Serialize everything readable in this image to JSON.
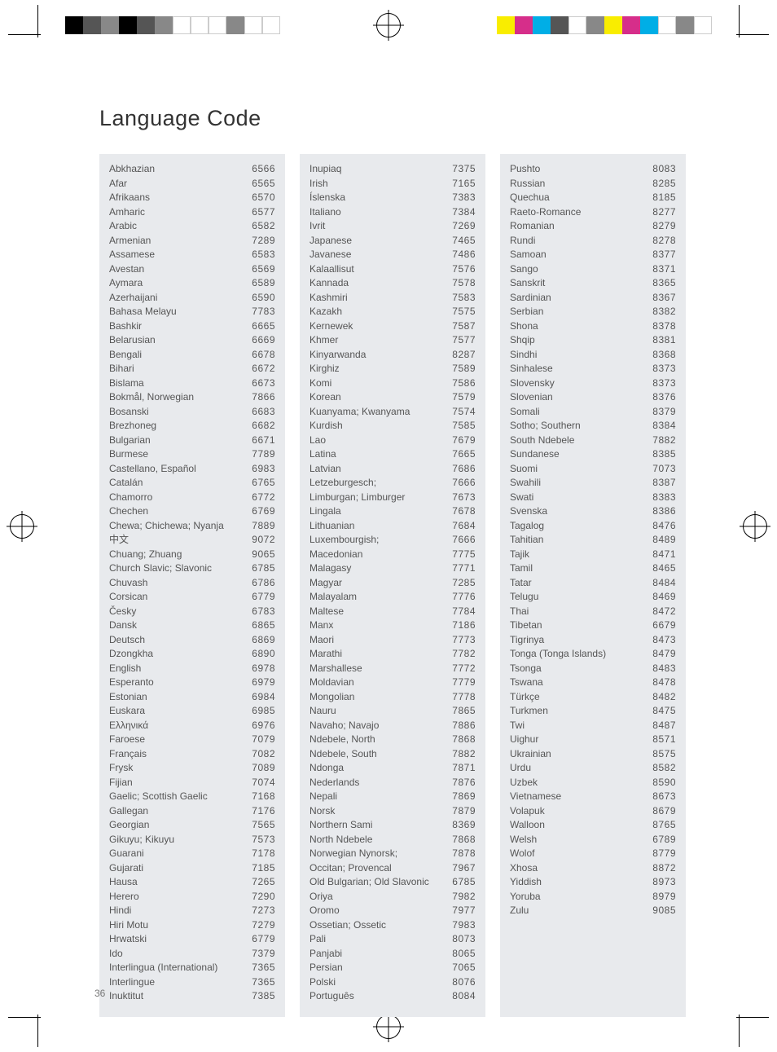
{
  "title": "Language Code",
  "page_number": "36",
  "swatches_left": [
    "#000000",
    "#555555",
    "#888888",
    "#000000",
    "#555555",
    "#888888",
    "#ffffff",
    "#ffffff",
    "#ffffff",
    "#888888",
    "#ffffff",
    "#ffffff"
  ],
  "swatches_right": [
    "#f9ed00",
    "#d62e8a",
    "#00aee6",
    "#555555",
    "#ffffff",
    "#888888",
    "#f9ed00",
    "#d62e8a",
    "#00aee6",
    "#ffffff",
    "#888888",
    "#ffffff"
  ],
  "columns": [
    [
      {
        "n": "Abkhazian",
        "c": "6566"
      },
      {
        "n": "Afar",
        "c": "6565"
      },
      {
        "n": "Afrikaans",
        "c": "6570"
      },
      {
        "n": "Amharic",
        "c": "6577"
      },
      {
        "n": "Arabic",
        "c": "6582"
      },
      {
        "n": "Armenian",
        "c": "7289"
      },
      {
        "n": "Assamese",
        "c": "6583"
      },
      {
        "n": "Avestan",
        "c": "6569"
      },
      {
        "n": "Aymara",
        "c": "6589"
      },
      {
        "n": "Azerhaijani",
        "c": "6590"
      },
      {
        "n": "Bahasa Melayu",
        "c": "7783"
      },
      {
        "n": "Bashkir",
        "c": "6665"
      },
      {
        "n": "Belarusian",
        "c": "6669"
      },
      {
        "n": "Bengali",
        "c": "6678"
      },
      {
        "n": "Bihari",
        "c": "6672"
      },
      {
        "n": "Bislama",
        "c": "6673"
      },
      {
        "n": "Bokmål, Norwegian",
        "c": "7866"
      },
      {
        "n": "Bosanski",
        "c": "6683"
      },
      {
        "n": "Brezhoneg",
        "c": "6682"
      },
      {
        "n": "Bulgarian",
        "c": "6671"
      },
      {
        "n": "Burmese",
        "c": "7789"
      },
      {
        "n": "Castellano, Español",
        "c": "6983"
      },
      {
        "n": "Catalán",
        "c": "6765"
      },
      {
        "n": "Chamorro",
        "c": "6772"
      },
      {
        "n": "Chechen",
        "c": "6769"
      },
      {
        "n": "Chewa; Chichewa; Nyanja",
        "c": "7889"
      },
      {
        "n": "中文",
        "c": "9072"
      },
      {
        "n": "Chuang; Zhuang",
        "c": "9065"
      },
      {
        "n": "Church Slavic; Slavonic",
        "c": "6785"
      },
      {
        "n": "Chuvash",
        "c": "6786"
      },
      {
        "n": "Corsican",
        "c": "6779"
      },
      {
        "n": "Česky",
        "c": "6783"
      },
      {
        "n": "Dansk",
        "c": "6865"
      },
      {
        "n": "Deutsch",
        "c": "6869"
      },
      {
        "n": "Dzongkha",
        "c": "6890"
      },
      {
        "n": "English",
        "c": "6978"
      },
      {
        "n": "Esperanto",
        "c": "6979"
      },
      {
        "n": "Estonian",
        "c": "6984"
      },
      {
        "n": "Euskara",
        "c": "6985"
      },
      {
        "n": "Ελληνικά",
        "c": "6976"
      },
      {
        "n": "Faroese",
        "c": "7079"
      },
      {
        "n": "Français",
        "c": "7082"
      },
      {
        "n": "Frysk",
        "c": "7089"
      },
      {
        "n": "Fijian",
        "c": "7074"
      },
      {
        "n": "Gaelic; Scottish Gaelic",
        "c": "7168"
      },
      {
        "n": "Gallegan",
        "c": "7176"
      },
      {
        "n": "Georgian",
        "c": "7565"
      },
      {
        "n": "Gikuyu; Kikuyu",
        "c": "7573"
      },
      {
        "n": "Guarani",
        "c": "7178"
      },
      {
        "n": "Gujarati",
        "c": "7185"
      },
      {
        "n": "Hausa",
        "c": "7265"
      },
      {
        "n": "Herero",
        "c": "7290"
      },
      {
        "n": "Hindi",
        "c": "7273"
      },
      {
        "n": "Hiri Motu",
        "c": "7279"
      },
      {
        "n": "Hrwatski",
        "c": "6779"
      },
      {
        "n": "Ido",
        "c": "7379"
      },
      {
        "n": "Interlingua (International)",
        "c": "7365"
      },
      {
        "n": "Interlingue",
        "c": "7365"
      },
      {
        "n": "Inuktitut",
        "c": "7385"
      }
    ],
    [
      {
        "n": "Inupiaq",
        "c": "7375"
      },
      {
        "n": "Irish",
        "c": "7165"
      },
      {
        "n": "Íslenska",
        "c": "7383"
      },
      {
        "n": "Italiano",
        "c": "7384"
      },
      {
        "n": "Ivrit",
        "c": "7269"
      },
      {
        "n": "Japanese",
        "c": "7465"
      },
      {
        "n": "Javanese",
        "c": "7486"
      },
      {
        "n": "Kalaallisut",
        "c": "7576"
      },
      {
        "n": "Kannada",
        "c": "7578"
      },
      {
        "n": "Kashmiri",
        "c": "7583"
      },
      {
        "n": "Kazakh",
        "c": "7575"
      },
      {
        "n": "Kernewek",
        "c": "7587"
      },
      {
        "n": "Khmer",
        "c": "7577"
      },
      {
        "n": "Kinyarwanda",
        "c": "8287"
      },
      {
        "n": "Kirghiz",
        "c": "7589"
      },
      {
        "n": "Komi",
        "c": "7586"
      },
      {
        "n": "Korean",
        "c": "7579"
      },
      {
        "n": "Kuanyama; Kwanyama",
        "c": "7574"
      },
      {
        "n": "Kurdish",
        "c": "7585"
      },
      {
        "n": "Lao",
        "c": "7679"
      },
      {
        "n": "Latina",
        "c": "7665"
      },
      {
        "n": "Latvian",
        "c": "7686"
      },
      {
        "n": "Letzeburgesch;",
        "c": "7666"
      },
      {
        "n": "Limburgan; Limburger",
        "c": "7673"
      },
      {
        "n": "Lingala",
        "c": "7678"
      },
      {
        "n": "Lithuanian",
        "c": "7684"
      },
      {
        "n": "Luxembourgish;",
        "c": "7666"
      },
      {
        "n": "Macedonian",
        "c": "7775"
      },
      {
        "n": "Malagasy",
        "c": "7771"
      },
      {
        "n": "Magyar",
        "c": "7285"
      },
      {
        "n": "Malayalam",
        "c": "7776"
      },
      {
        "n": "Maltese",
        "c": "7784"
      },
      {
        "n": "Manx",
        "c": "7186"
      },
      {
        "n": "Maori",
        "c": "7773"
      },
      {
        "n": "Marathi",
        "c": "7782"
      },
      {
        "n": "Marshallese",
        "c": "7772"
      },
      {
        "n": "Moldavian",
        "c": "7779"
      },
      {
        "n": "Mongolian",
        "c": "7778"
      },
      {
        "n": "Nauru",
        "c": "7865"
      },
      {
        "n": "Navaho; Navajo",
        "c": "7886"
      },
      {
        "n": "Ndebele, North",
        "c": "7868"
      },
      {
        "n": "Ndebele, South",
        "c": "7882"
      },
      {
        "n": "Ndonga",
        "c": "7871"
      },
      {
        "n": "Nederlands",
        "c": "7876"
      },
      {
        "n": "Nepali",
        "c": "7869"
      },
      {
        "n": "Norsk",
        "c": "7879"
      },
      {
        "n": "Northern Sami",
        "c": "8369"
      },
      {
        "n": "North Ndebele",
        "c": "7868"
      },
      {
        "n": "Norwegian Nynorsk;",
        "c": "7878"
      },
      {
        "n": "Occitan; Provencal",
        "c": "7967"
      },
      {
        "n": "Old Bulgarian; Old Slavonic",
        "c": "6785"
      },
      {
        "n": "Oriya",
        "c": "7982"
      },
      {
        "n": "Oromo",
        "c": "7977"
      },
      {
        "n": "Ossetian; Ossetic",
        "c": "7983"
      },
      {
        "n": "Pali",
        "c": "8073"
      },
      {
        "n": "Panjabi",
        "c": "8065"
      },
      {
        "n": "Persian",
        "c": "7065"
      },
      {
        "n": "Polski",
        "c": "8076"
      },
      {
        "n": "Português",
        "c": "8084"
      }
    ],
    [
      {
        "n": "Pushto",
        "c": "8083"
      },
      {
        "n": "Russian",
        "c": "8285"
      },
      {
        "n": "Quechua",
        "c": "8185"
      },
      {
        "n": "Raeto-Romance",
        "c": "8277"
      },
      {
        "n": "Romanian",
        "c": "8279"
      },
      {
        "n": "Rundi",
        "c": "8278"
      },
      {
        "n": "Samoan",
        "c": "8377"
      },
      {
        "n": "Sango",
        "c": "8371"
      },
      {
        "n": "Sanskrit",
        "c": "8365"
      },
      {
        "n": "Sardinian",
        "c": "8367"
      },
      {
        "n": "Serbian",
        "c": "8382"
      },
      {
        "n": "Shona",
        "c": "8378"
      },
      {
        "n": "Shqip",
        "c": "8381"
      },
      {
        "n": "Sindhi",
        "c": "8368"
      },
      {
        "n": "Sinhalese",
        "c": "8373"
      },
      {
        "n": "Slovensky",
        "c": "8373"
      },
      {
        "n": "Slovenian",
        "c": "8376"
      },
      {
        "n": "Somali",
        "c": "8379"
      },
      {
        "n": "Sotho; Southern",
        "c": "8384"
      },
      {
        "n": "South Ndebele",
        "c": "7882"
      },
      {
        "n": "Sundanese",
        "c": "8385"
      },
      {
        "n": "Suomi",
        "c": "7073"
      },
      {
        "n": "Swahili",
        "c": "8387"
      },
      {
        "n": "Swati",
        "c": "8383"
      },
      {
        "n": "Svenska",
        "c": "8386"
      },
      {
        "n": "Tagalog",
        "c": "8476"
      },
      {
        "n": "Tahitian",
        "c": "8489"
      },
      {
        "n": "Tajik",
        "c": "8471"
      },
      {
        "n": "Tamil",
        "c": "8465"
      },
      {
        "n": "Tatar",
        "c": "8484"
      },
      {
        "n": "Telugu",
        "c": "8469"
      },
      {
        "n": "Thai",
        "c": "8472"
      },
      {
        "n": "Tibetan",
        "c": "6679"
      },
      {
        "n": "Tigrinya",
        "c": "8473"
      },
      {
        "n": "Tonga (Tonga Islands)",
        "c": "8479"
      },
      {
        "n": "Tsonga",
        "c": "8483"
      },
      {
        "n": "Tswana",
        "c": "8478"
      },
      {
        "n": "Türkçe",
        "c": "8482"
      },
      {
        "n": "Turkmen",
        "c": "8475"
      },
      {
        "n": "Twi",
        "c": "8487"
      },
      {
        "n": "Uighur",
        "c": "8571"
      },
      {
        "n": "Ukrainian",
        "c": "8575"
      },
      {
        "n": "Urdu",
        "c": "8582"
      },
      {
        "n": "Uzbek",
        "c": "8590"
      },
      {
        "n": "Vietnamese",
        "c": "8673"
      },
      {
        "n": "Volapuk",
        "c": "8679"
      },
      {
        "n": "Walloon",
        "c": "8765"
      },
      {
        "n": "Welsh",
        "c": "6789"
      },
      {
        "n": "Wolof",
        "c": "8779"
      },
      {
        "n": "Xhosa",
        "c": "8872"
      },
      {
        "n": "Yiddish",
        "c": "8973"
      },
      {
        "n": "Yoruba",
        "c": "8979"
      },
      {
        "n": "Zulu",
        "c": "9085"
      }
    ]
  ]
}
